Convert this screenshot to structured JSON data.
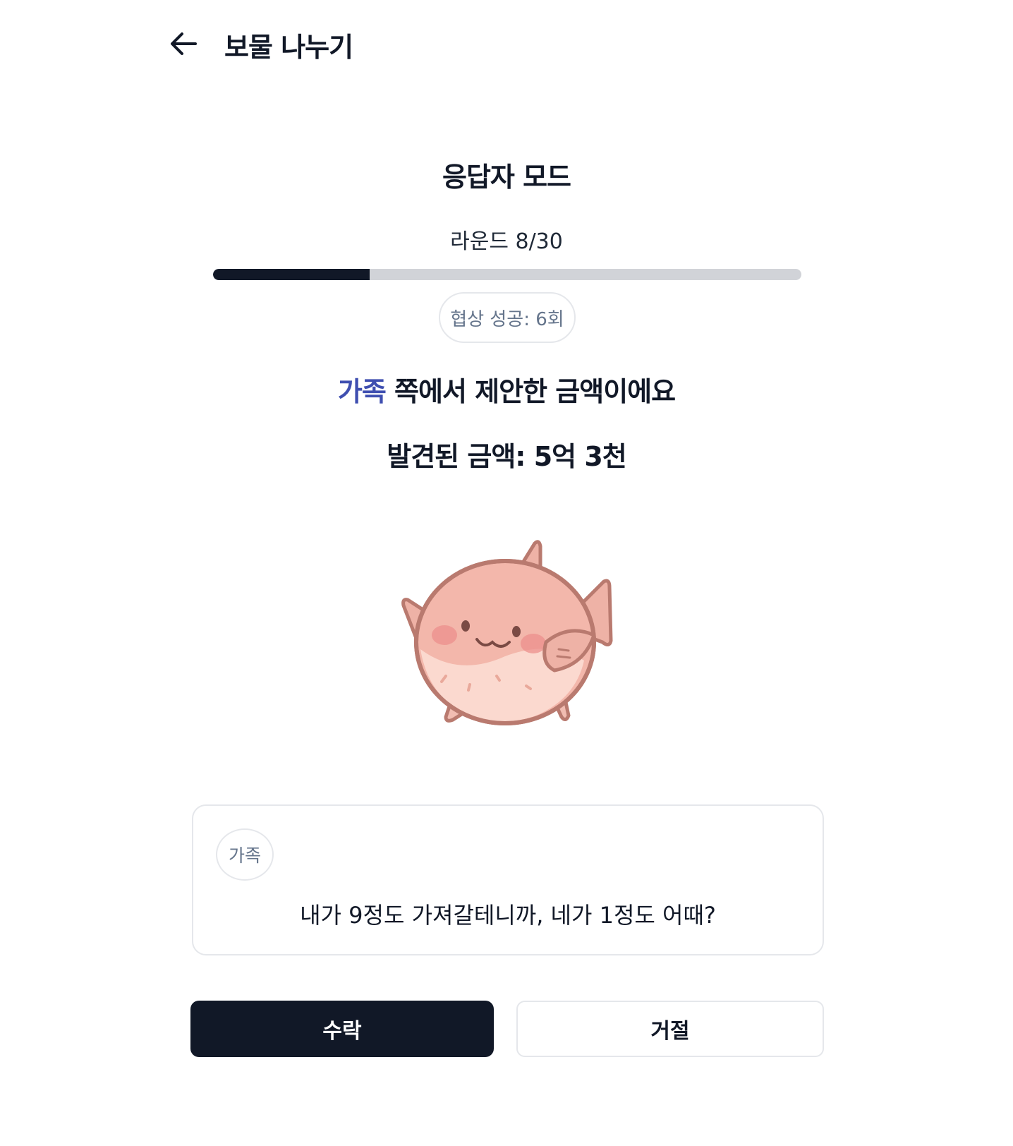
{
  "header": {
    "back_icon": "arrow-left-icon",
    "title": "보물 나누기"
  },
  "game": {
    "mode_title": "응답자 모드",
    "round_label": "라운드 8/30",
    "round_current": 8,
    "round_total": 30,
    "progress_fraction": 0.2667,
    "success_badge": "협상 성공: 6회",
    "proposer_name": "가족",
    "proposer_suffix": " 쪽에서 제안한 금액이에요",
    "found_amount": "발견된 금액: 5억 3천",
    "mascot": "pufferfish-illustration"
  },
  "message": {
    "speaker": "가족",
    "text": "내가 9정도 가져갈테니까, 네가 1정도 어때?"
  },
  "actions": {
    "accept_label": "수락",
    "reject_label": "거절"
  },
  "colors": {
    "primary": "#111827",
    "accent": "#3f4fb0",
    "muted": "#64748b",
    "track": "#d1d3d8",
    "border": "#e5e7eb"
  }
}
